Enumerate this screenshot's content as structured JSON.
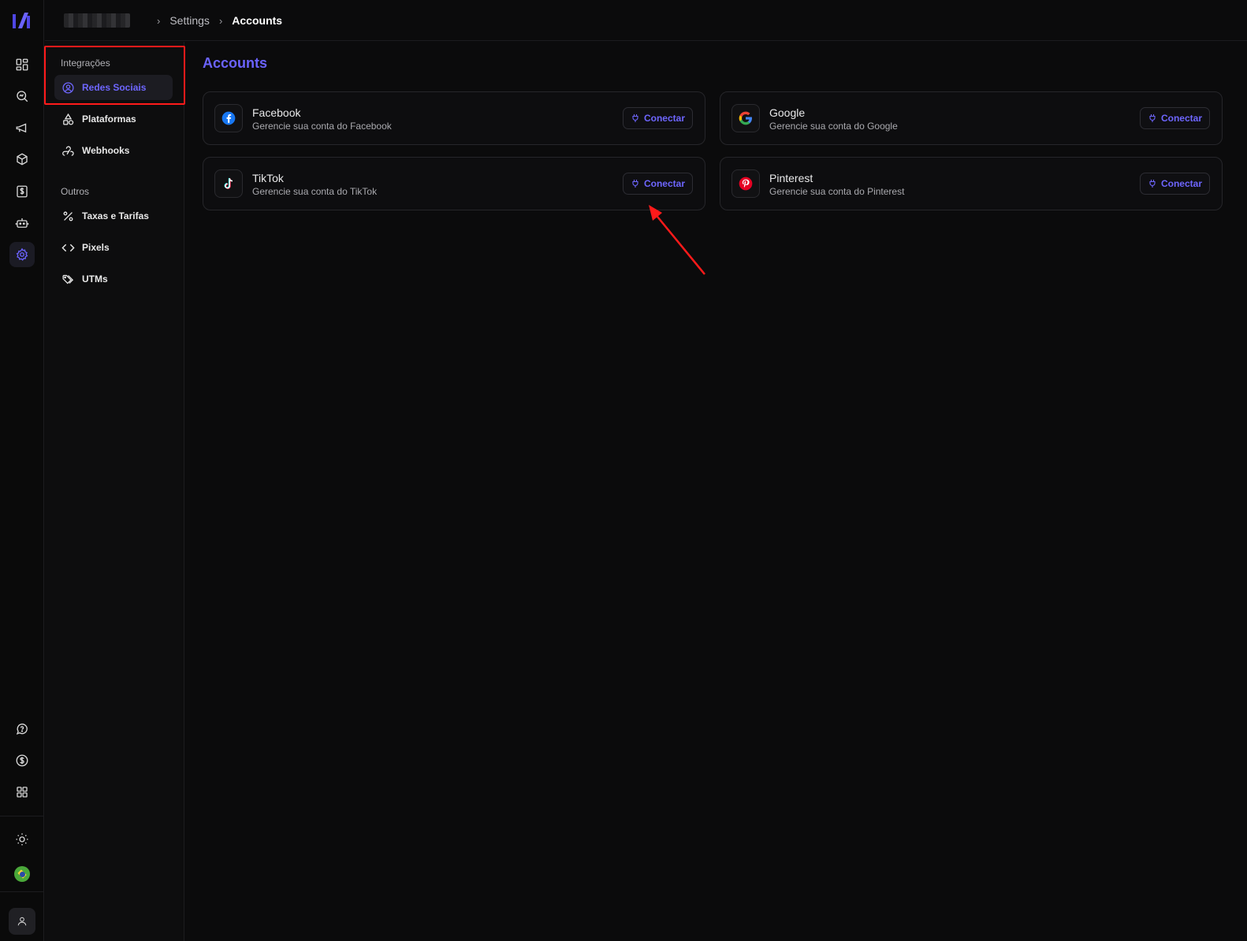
{
  "breadcrumb": {
    "items": [
      "Settings",
      "Accounts"
    ]
  },
  "sidebar": {
    "sections": [
      {
        "title": "Integrações",
        "items": [
          {
            "label": "Redes Sociais",
            "icon": "user-circle-icon",
            "active": true
          },
          {
            "label": "Plataformas",
            "icon": "shapes-icon"
          },
          {
            "label": "Webhooks",
            "icon": "webhook-icon"
          }
        ]
      },
      {
        "title": "Outros",
        "items": [
          {
            "label": "Taxas e Tarifas",
            "icon": "percent-icon"
          },
          {
            "label": "Pixels",
            "icon": "code-icon"
          },
          {
            "label": "UTMs",
            "icon": "tags-icon"
          }
        ]
      }
    ]
  },
  "main": {
    "title": "Accounts",
    "cards": [
      {
        "name": "Facebook",
        "description": "Gerencie sua conta do Facebook",
        "button": "Conectar",
        "icon": "facebook-icon"
      },
      {
        "name": "Google",
        "description": "Gerencie sua conta do Google",
        "button": "Conectar",
        "icon": "google-icon"
      },
      {
        "name": "TikTok",
        "description": "Gerencie sua conta do TikTok",
        "button": "Conectar",
        "icon": "tiktok-icon"
      },
      {
        "name": "Pinterest",
        "description": "Gerencie sua conta do Pinterest",
        "button": "Conectar",
        "icon": "pinterest-icon"
      }
    ]
  },
  "colors": {
    "accent": "#6b63ff",
    "background": "#0b0b0c",
    "annotation": "#ff1a1a"
  }
}
